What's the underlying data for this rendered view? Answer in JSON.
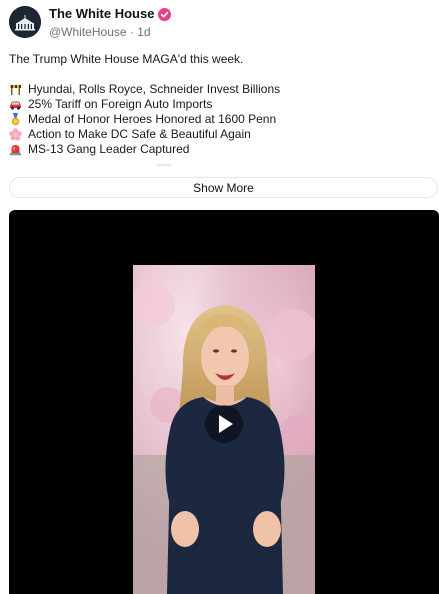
{
  "author": {
    "display_name": "The White House",
    "handle": "@WhiteHouse",
    "separator": "·",
    "time": "1d",
    "verified_color": "#e83e8c"
  },
  "post": {
    "intro": "The Trump White House MAGA'd this week.",
    "bullets": [
      {
        "icon": "construction-icon",
        "text": "Hyundai, Rolls Royce, Schneider Invest Billions"
      },
      {
        "icon": "car-icon",
        "text": "25% Tariff on Foreign Auto Imports"
      },
      {
        "icon": "medal-icon",
        "text": "Medal of Honor Heroes Honored at 1600 Penn"
      },
      {
        "icon": "cherry-blossom-icon",
        "text": "Action to Make DC Safe & Beautiful Again"
      },
      {
        "icon": "siren-icon",
        "text": "MS-13 Gang Leader Captured"
      }
    ]
  },
  "show_more_label": "Show More",
  "video": {
    "background_color": "#000000",
    "play_icon": "play-icon"
  }
}
